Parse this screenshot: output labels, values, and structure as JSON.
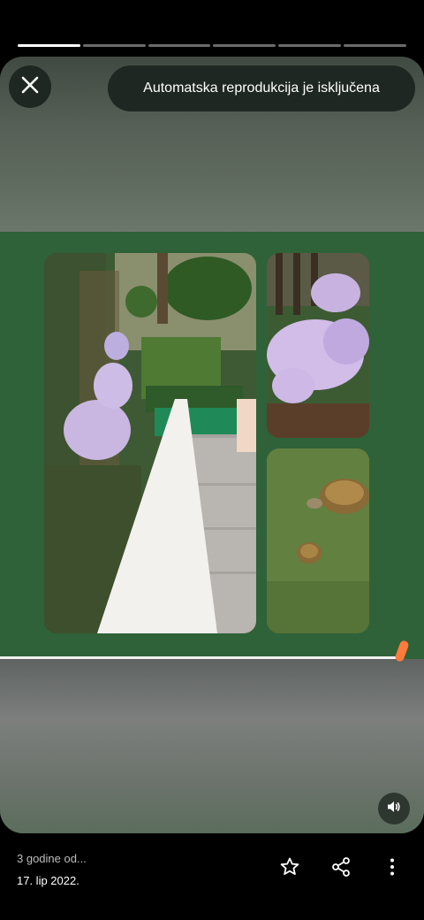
{
  "story": {
    "autoplay_status": "Automatska reprodukcija je isključena",
    "segments": 6,
    "active_segment": 1
  },
  "footer": {
    "relative_time": "3 godine od...",
    "date": "17. lip 2022."
  },
  "icons": {
    "close": "close-icon",
    "volume": "volume-icon",
    "star": "star-icon",
    "share": "share-icon",
    "more": "more-vertical-icon"
  },
  "colors": {
    "green_band": "#2f6238",
    "scrubber_handle": "#ff7a3c"
  }
}
